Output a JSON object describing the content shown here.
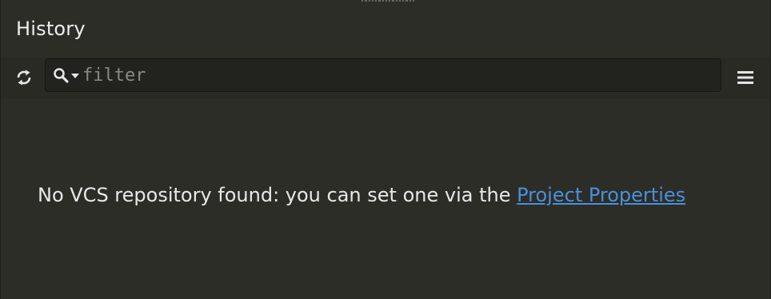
{
  "panel": {
    "title": "History"
  },
  "toolbar": {
    "refresh_icon": "refresh-icon",
    "search_mode_icon": "search-icon",
    "search_dropdown_icon": "chevron-down-icon",
    "search_placeholder": "filter",
    "search_value": "",
    "menu_icon": "hamburger-menu-icon"
  },
  "content": {
    "empty_message": "No VCS repository found: you can set one via the",
    "empty_link": "Project Properties"
  },
  "colors": {
    "background": "#2d2d28",
    "toolbar_background": "#2a2a25",
    "search_background": "#22221e",
    "text": "#e8e8e8",
    "placeholder": "#8a8a85",
    "link": "#4a90d9"
  }
}
